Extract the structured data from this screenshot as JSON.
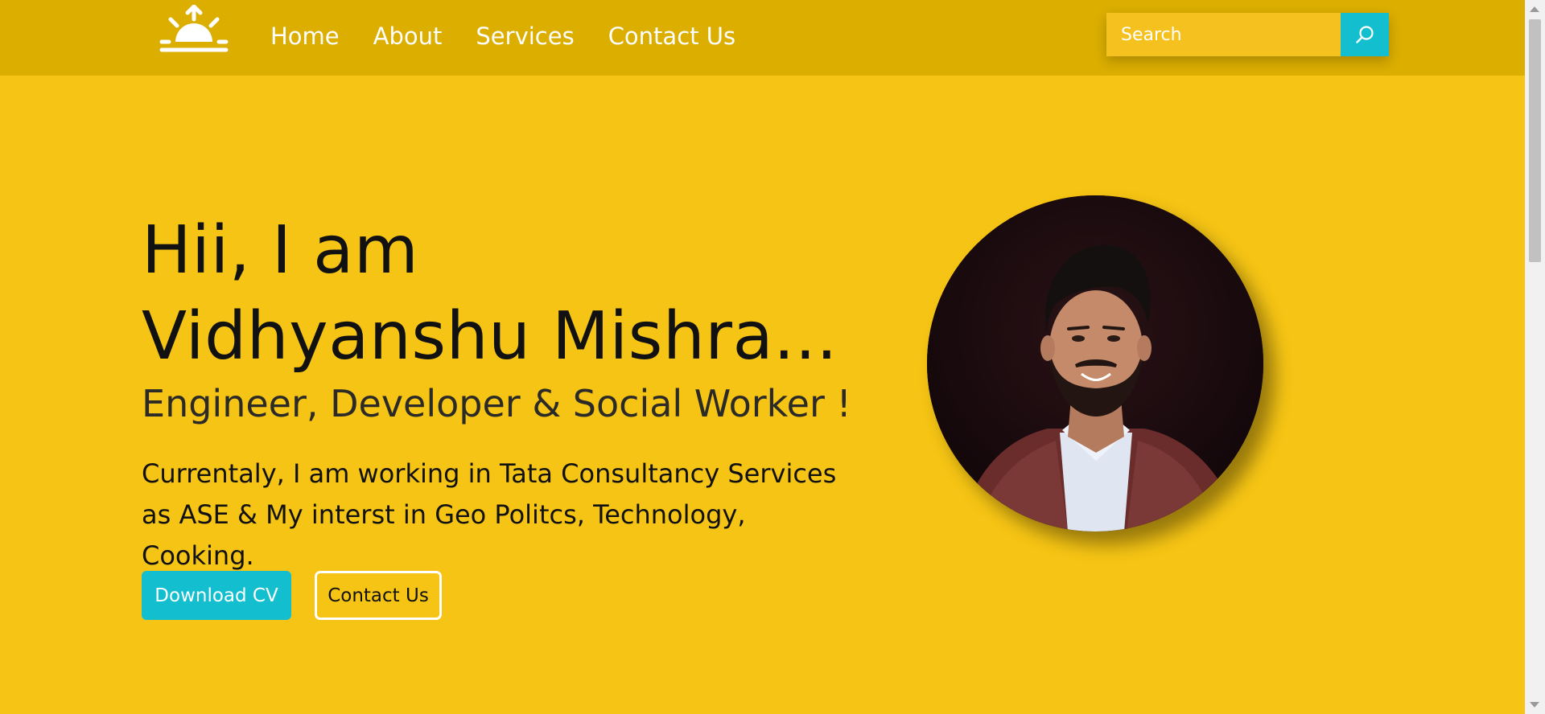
{
  "nav": {
    "logo_icon": "sunrise-icon",
    "links": [
      "Home",
      "About",
      "Services",
      "Contact Us"
    ],
    "search_placeholder": "Search",
    "search_icon": "search-icon"
  },
  "hero": {
    "title_line1": "Hii, I am",
    "title_line2": "Vidhyanshu Mishra...",
    "subtitle": "Engineer, Developer & Social Worker !",
    "description": "Currentaly, I am working in Tata Consultancy Services as ASE & My interst in Geo Politcs, Technology, Cooking.",
    "download_label": "Download CV",
    "contact_label": "Contact Us"
  },
  "colors": {
    "background": "#f5c414",
    "navbar": "#dbae00",
    "accent": "#13bfcf"
  }
}
